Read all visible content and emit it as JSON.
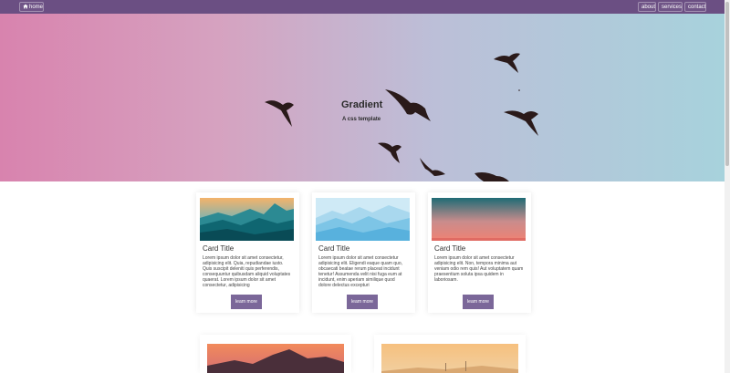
{
  "nav": {
    "home_label": "home",
    "about_label": "about",
    "services_label": "services",
    "contact_label": "contact"
  },
  "hero": {
    "title": "Gradient",
    "subtitle": "A css template"
  },
  "cards": [
    {
      "title": "Card Title",
      "text": "Lorem ipsum dolor sit amet consectetur, adipisicing elit. Quia, repudiandae iusto. Quis suscipit deleniti quis perferendis, consequuntur quibusdam aliquid voluptates quaerat. Lorem ipsum dolor sit amet consectetur, adipisicing",
      "button": "learn more"
    },
    {
      "title": "Card Title",
      "text": "Lorem ipsum dolor sit amet consectetur adipisicing elit. Eligendi eaque quam quo, obcaecati beatae rerum placeat incidunt tenetur! Assumenda velit nisi fuga eum at incidunt, enim aperiam similique quod dolore delectus excepturi",
      "button": "learn more"
    },
    {
      "title": "Card Title",
      "text": "Lorem ipsum dolor sit amet consectetur adipisicing elit. Non, tempora minima aut veniam odio rem quis! Aut voluptatem quam praesentium soluta ipsa quidem in laboriosam.",
      "button": "learn more"
    }
  ],
  "colors": {
    "navbar": "#6b4f83",
    "button": "#7b6799",
    "hero_left": "#d883ae",
    "hero_right": "#a7d2dc"
  }
}
